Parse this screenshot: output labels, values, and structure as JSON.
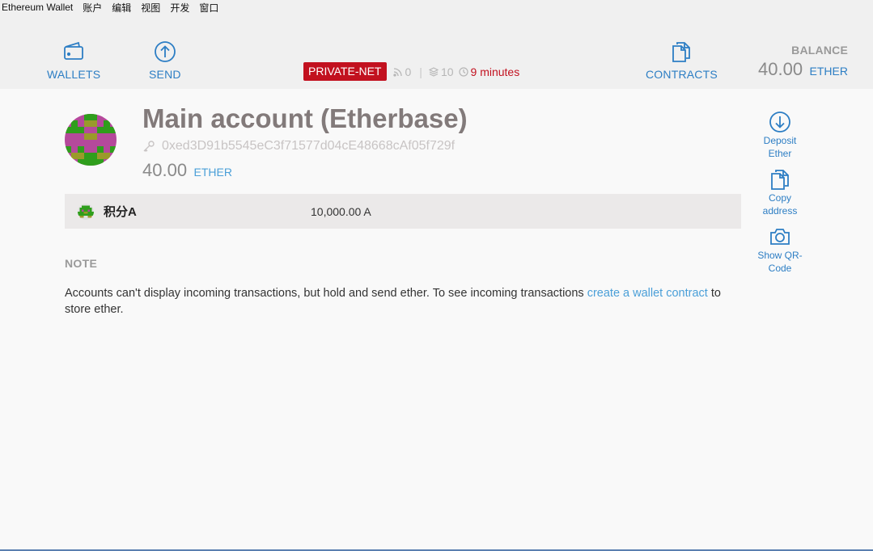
{
  "window": {
    "app_title": "Ethereum Wallet",
    "menu": [
      "账户",
      "编辑",
      "视图",
      "开发",
      "窗口"
    ]
  },
  "header": {
    "wallets_label": "WALLETS",
    "send_label": "SEND",
    "contracts_label": "CONTRACTS",
    "network_badge": "PRIVATE-NET",
    "peers": "0",
    "block": "10",
    "last_block_time": "9 minutes",
    "balance_label": "BALANCE",
    "balance_value": "40.00",
    "balance_unit": "ETHER"
  },
  "account": {
    "title": "Main account (Etherbase)",
    "address": "0xed3D91b5545eC3f71577d04cE48668cAf05f729f",
    "balance_value": "40.00",
    "balance_unit": "ETHER"
  },
  "tokens": [
    {
      "name": "积分A",
      "balance": "10,000.00 A"
    }
  ],
  "note": {
    "title": "NOTE",
    "text_before": "Accounts can't display incoming transactions, but hold and send ether. To see incoming transactions ",
    "link": "create a wallet contract",
    "text_after": " to store ether."
  },
  "actions": {
    "deposit": "Deposit Ether",
    "copy": "Copy address",
    "qr": "Show QR-Code"
  },
  "colors": {
    "accent": "#2d7ec4",
    "network_badge": "#c2111f",
    "identicon_magenta": "#b5499b",
    "identicon_green": "#2f9e1c",
    "identicon_olive": "#9a9a2a"
  },
  "icons": {
    "wallets": "wallet-icon",
    "send": "arrow-up-circle-icon",
    "contracts": "documents-icon",
    "deposit": "arrow-down-circle-icon",
    "copy": "copy-documents-icon",
    "qr": "camera-icon",
    "address": "key-icon"
  }
}
